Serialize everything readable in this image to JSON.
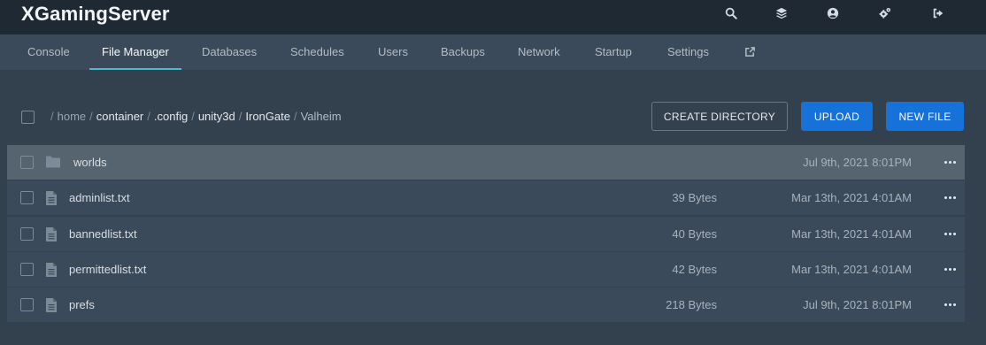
{
  "header": {
    "brand": "XGamingServer",
    "icons": [
      "search-icon",
      "layers-icon",
      "account-icon",
      "settings-cogs-icon",
      "sign-out-icon"
    ]
  },
  "nav": {
    "tabs": [
      {
        "label": "Console",
        "active": false
      },
      {
        "label": "File Manager",
        "active": true
      },
      {
        "label": "Databases",
        "active": false
      },
      {
        "label": "Schedules",
        "active": false
      },
      {
        "label": "Users",
        "active": false
      },
      {
        "label": "Backups",
        "active": false
      },
      {
        "label": "Network",
        "active": false
      },
      {
        "label": "Startup",
        "active": false
      },
      {
        "label": "Settings",
        "active": false
      }
    ],
    "external_icon": "external-link-icon"
  },
  "breadcrumb": {
    "parts": [
      "home",
      "container",
      ".config",
      "unity3d",
      "IronGate"
    ],
    "current": "Valheim"
  },
  "actions": {
    "create_directory": "CREATE DIRECTORY",
    "upload": "UPLOAD",
    "new_file": "NEW FILE"
  },
  "files": [
    {
      "name": "worlds",
      "type": "folder",
      "size": "",
      "modified": "Jul 9th, 2021 8:01PM"
    },
    {
      "name": "adminlist.txt",
      "type": "file",
      "size": "39 Bytes",
      "modified": "Mar 13th, 2021 4:01AM"
    },
    {
      "name": "bannedlist.txt",
      "type": "file",
      "size": "40 Bytes",
      "modified": "Mar 13th, 2021 4:01AM"
    },
    {
      "name": "permittedlist.txt",
      "type": "file",
      "size": "42 Bytes",
      "modified": "Mar 13th, 2021 4:01AM"
    },
    {
      "name": "prefs",
      "type": "file",
      "size": "218 Bytes",
      "modified": "Jul 9th, 2021 8:01PM"
    }
  ],
  "colors": {
    "accent": "#3fc1d0",
    "primary_button": "#1672d8",
    "background": "#33404d",
    "topbar": "#1f2933"
  }
}
